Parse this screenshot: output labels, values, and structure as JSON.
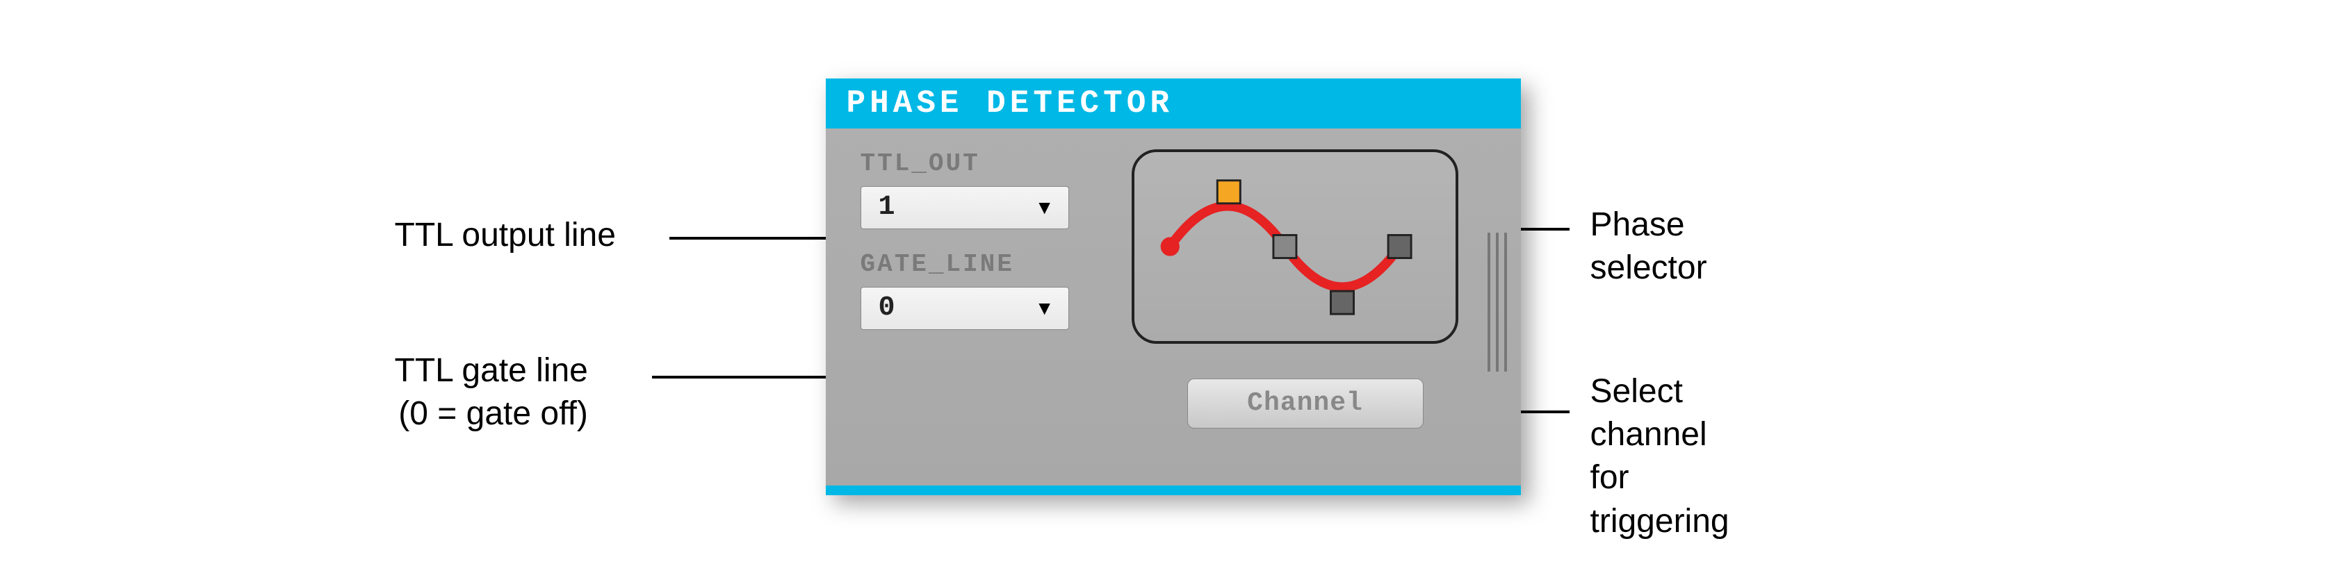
{
  "title": "PHASE DETECTOR",
  "controls": {
    "ttl_out": {
      "label": "TTL_OUT",
      "value": "1"
    },
    "gate_line": {
      "label": "GATE_LINE",
      "value": "0"
    }
  },
  "channel_button": "Channel",
  "annotations": {
    "ttl_output": "TTL output line",
    "ttl_gate": "TTL gate line",
    "gate_off": "(0 = gate off)",
    "phase_selector": "Phase selector",
    "select_channel_1": "Select channel",
    "select_channel_2": "for triggering"
  }
}
